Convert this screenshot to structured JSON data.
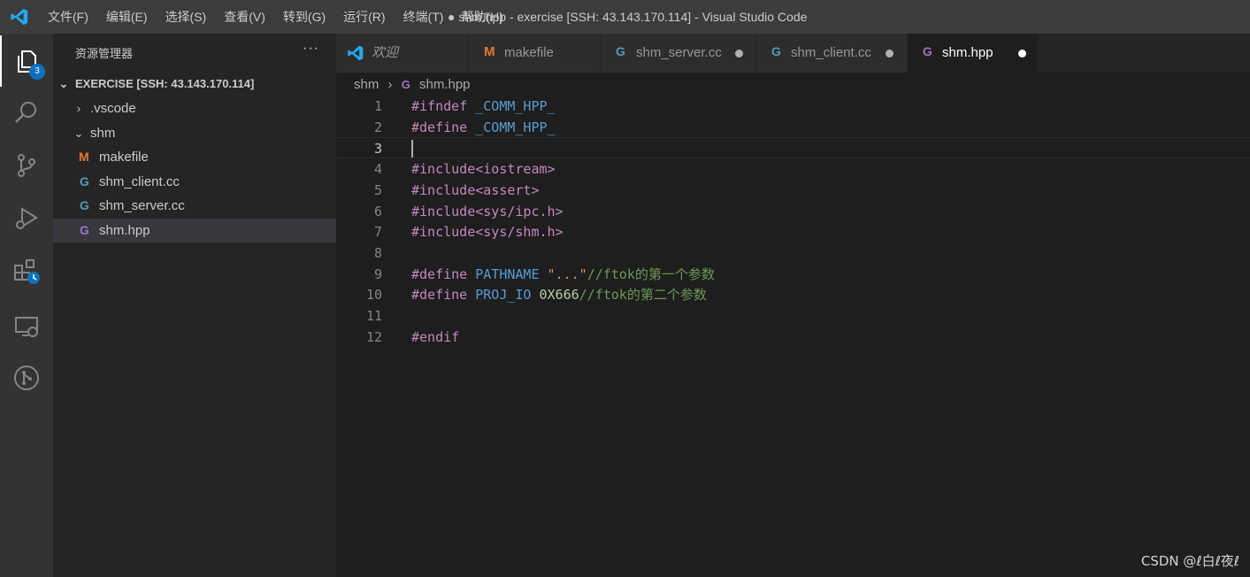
{
  "titlebar": {
    "menu": [
      "文件(F)",
      "编辑(E)",
      "选择(S)",
      "查看(V)",
      "转到(G)",
      "运行(R)",
      "终端(T)",
      "帮助(H)"
    ],
    "title": "● shm.hpp - exercise [SSH: 43.143.170.114] - Visual Studio Code"
  },
  "activity_bar": {
    "explorer_badge": "3",
    "icons": [
      "files-icon",
      "search-icon",
      "source-control-icon",
      "run-debug-icon",
      "extensions-icon",
      "remote-explorer-icon",
      "git-graph-icon"
    ]
  },
  "sidebar": {
    "header": "资源管理器",
    "more": "···",
    "root": "EXERCISE [SSH: 43.143.170.114]",
    "items": [
      {
        "label": ".vscode",
        "kind": "folder",
        "expanded": false
      },
      {
        "label": "shm",
        "kind": "folder",
        "expanded": true
      },
      {
        "label": "makefile",
        "kind": "makefile"
      },
      {
        "label": "shm_client.cc",
        "kind": "cpp"
      },
      {
        "label": "shm_server.cc",
        "kind": "cpp"
      },
      {
        "label": "shm.hpp",
        "kind": "hpp",
        "selected": true
      }
    ]
  },
  "tabs": [
    {
      "label": "欢迎",
      "kind": "welcome",
      "modified": false
    },
    {
      "label": "makefile",
      "kind": "makefile",
      "modified": false
    },
    {
      "label": "shm_server.cc",
      "kind": "cpp",
      "modified": true
    },
    {
      "label": "shm_client.cc",
      "kind": "cpp",
      "modified": true
    },
    {
      "label": "shm.hpp",
      "kind": "hpp",
      "modified": true,
      "active": true
    }
  ],
  "breadcrumb": {
    "folder": "shm",
    "file": "shm.hpp"
  },
  "editor": {
    "current_line": 3,
    "line_numbers": [
      "1",
      "2",
      "3",
      "4",
      "5",
      "6",
      "7",
      "8",
      "9",
      "10",
      "11",
      "12"
    ],
    "lines": [
      [
        {
          "t": "#ifndef",
          "c": "kw"
        },
        {
          "t": " ",
          "c": "ws"
        },
        {
          "t": "_COMM_HPP_",
          "c": "mac"
        }
      ],
      [
        {
          "t": "#define",
          "c": "kw"
        },
        {
          "t": " ",
          "c": "ws"
        },
        {
          "t": "_COMM_HPP_",
          "c": "mac"
        }
      ],
      [],
      [
        {
          "t": "#include",
          "c": "kw"
        },
        {
          "t": "<iostream>",
          "c": "kw"
        }
      ],
      [
        {
          "t": "#include",
          "c": "kw"
        },
        {
          "t": "<assert>",
          "c": "kw"
        }
      ],
      [
        {
          "t": "#include",
          "c": "kw"
        },
        {
          "t": "<sys/ipc.h>",
          "c": "kw"
        }
      ],
      [
        {
          "t": "#include",
          "c": "kw"
        },
        {
          "t": "<sys/shm.h>",
          "c": "kw"
        }
      ],
      [],
      [
        {
          "t": "#define",
          "c": "kw"
        },
        {
          "t": " ",
          "c": "ws"
        },
        {
          "t": "PATHNAME",
          "c": "mac"
        },
        {
          "t": " ",
          "c": "ws"
        },
        {
          "t": "\"...\"",
          "c": "str"
        },
        {
          "t": "//ftok的第一个参数",
          "c": "cmt"
        }
      ],
      [
        {
          "t": "#define",
          "c": "kw"
        },
        {
          "t": " ",
          "c": "ws"
        },
        {
          "t": "PROJ_IO",
          "c": "mac"
        },
        {
          "t": " ",
          "c": "ws"
        },
        {
          "t": "0X666",
          "c": "num"
        },
        {
          "t": "//ftok的第二个参数",
          "c": "cmt"
        }
      ],
      [],
      [
        {
          "t": "#endif",
          "c": "kw"
        }
      ]
    ]
  },
  "watermark": "CSDN @ℓ白ℓ夜ℓ",
  "colors": {
    "accent": "#0e70c0",
    "keyword": "#c586c0",
    "macro": "#569cd6",
    "string": "#ce9178",
    "comment": "#6a9955",
    "number": "#b5cea8"
  }
}
